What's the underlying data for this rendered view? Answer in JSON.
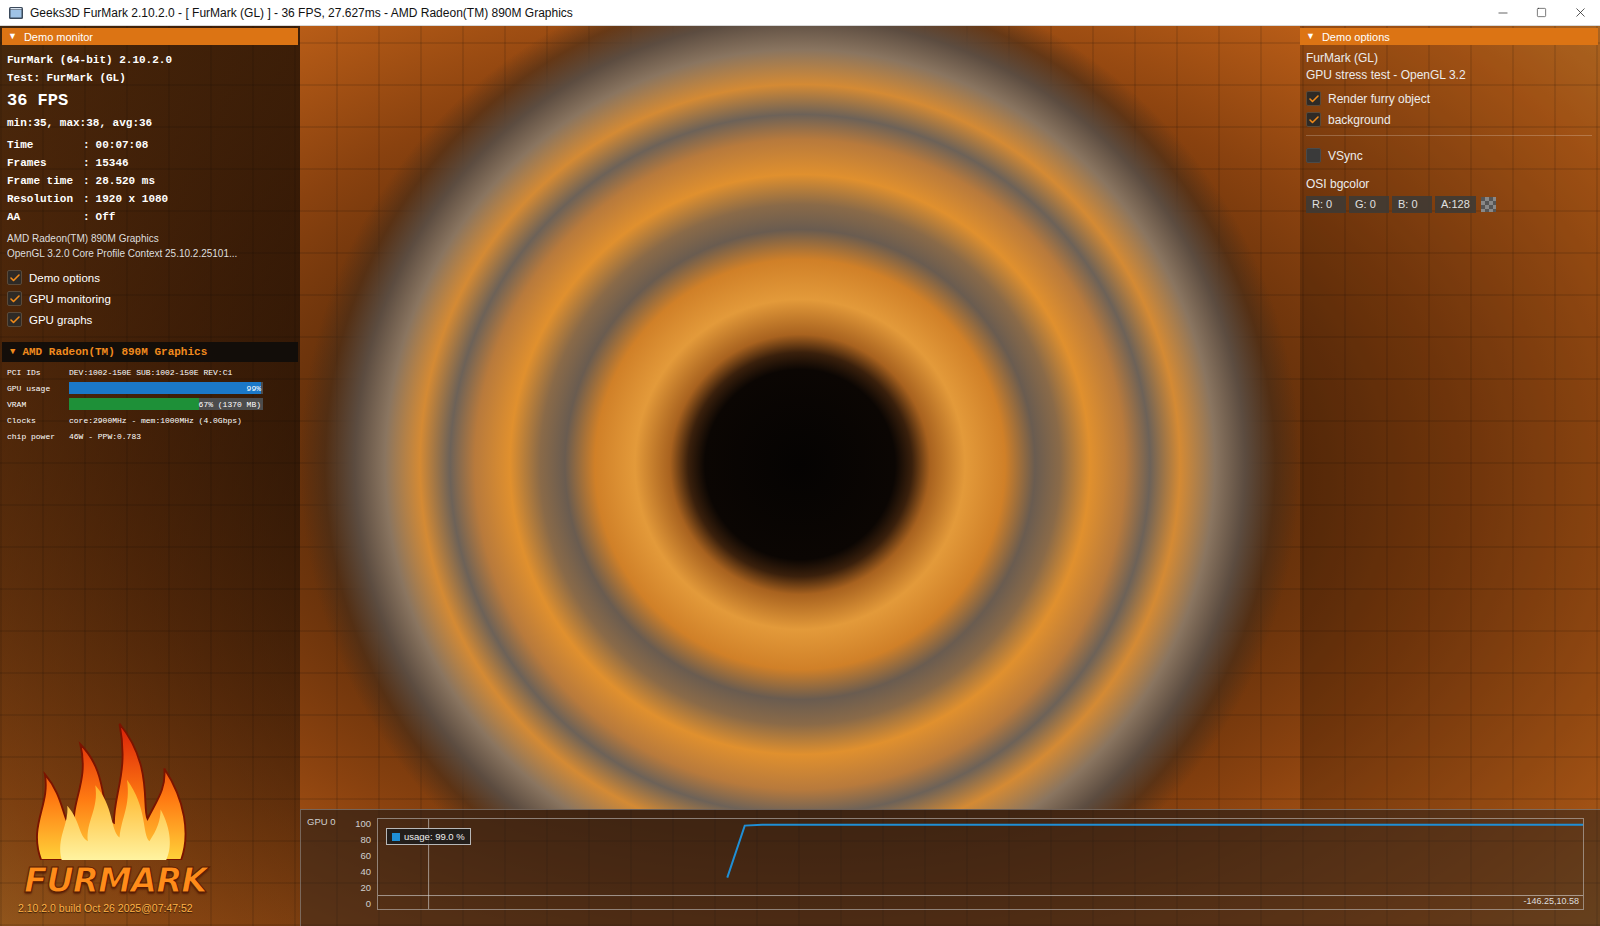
{
  "window": {
    "title": "Geeks3D FurMark 2.10.2.0 - [ FurMark (GL) ] - 36 FPS, 27.627ms - AMD Radeon(TM) 890M Graphics"
  },
  "demo_monitor": {
    "header": {
      "toggle": "▼",
      "title": "Demo monitor"
    },
    "app": "FurMark (64-bit) 2.10.2.0",
    "test": "Test: FurMark (GL)",
    "fps": "36 FPS",
    "fps_stats": "min:35, max:38, avg:36",
    "separator": ":",
    "stats": [
      {
        "label": "Time",
        "value": "00:07:08"
      },
      {
        "label": "Frames",
        "value": "15346"
      },
      {
        "label": "Frame time",
        "value": "28.520 ms"
      },
      {
        "label": "Resolution",
        "value": "1920 x 1080"
      },
      {
        "label": "AA",
        "value": "Off"
      }
    ],
    "gpu_name": "AMD Radeon(TM) 890M Graphics",
    "gl_context": "OpenGL 3.2.0 Core Profile Context 25.10.2.25101...",
    "options": [
      {
        "label": "Demo options",
        "checked": true
      },
      {
        "label": "GPU monitoring",
        "checked": true
      },
      {
        "label": "GPU graphs",
        "checked": true
      }
    ]
  },
  "gpu_monitor": {
    "header": {
      "toggle": "▼",
      "title": "AMD Radeon(TM) 890M Graphics"
    },
    "rows": [
      {
        "kind": "text",
        "label": "PCI IDs",
        "value": "DEV:1002-150E SUB:1002-150E REV:C1"
      },
      {
        "kind": "bar",
        "label": "GPU usage",
        "value": "99%",
        "level": 0.99,
        "color": "#1b78c8"
      },
      {
        "kind": "bar",
        "label": "VRAM",
        "value": "67% (1370 MB)",
        "level": 0.67,
        "color": "#1e9038"
      },
      {
        "kind": "text",
        "label": "Clocks",
        "value": "core:2900MHz - mem:1000MHz (4.0Gbps)"
      },
      {
        "kind": "text",
        "label": "chip power",
        "value": "46W - PPW:0.783"
      }
    ]
  },
  "logo": {
    "text": "FURMARK",
    "build": "2.10.2.0 build Oct 26 2025@07:47:52"
  },
  "demo_options": {
    "header": {
      "toggle": "▼",
      "title": "Demo options"
    },
    "title": "FurMark (GL)",
    "subtitle": "GPU stress test - OpenGL 3.2",
    "options": [
      {
        "label": "Render furry object",
        "checked": true
      },
      {
        "label": "background",
        "checked": true
      }
    ],
    "sync_options": [
      {
        "label": "VSync",
        "checked": false
      }
    ],
    "bgcolor": {
      "label": "OSI bgcolor",
      "fields": [
        "R: 0",
        "G: 0",
        "B: 0",
        "A:128"
      ]
    }
  },
  "graph": {
    "label": "GPU 0",
    "y_ticks": [
      "100",
      "80",
      "60",
      "40",
      "20",
      "0"
    ],
    "series": [
      {
        "legend": "usage: 99.0 %",
        "color": "#1f8fd6",
        "values": [
          33,
          98,
          99,
          99,
          99,
          99,
          99,
          99,
          99,
          99,
          99,
          99,
          99,
          99,
          99,
          99,
          99,
          99,
          99,
          99,
          99,
          99,
          99,
          99,
          99,
          99,
          99,
          99,
          99,
          99,
          99,
          99,
          99,
          99,
          99,
          99,
          99,
          99,
          99,
          99,
          99,
          99,
          99,
          99,
          99,
          99,
          99,
          99,
          99,
          99
        ]
      }
    ],
    "cursor": {
      "readout": "-146.25,10.58",
      "value": 10.58
    }
  }
}
